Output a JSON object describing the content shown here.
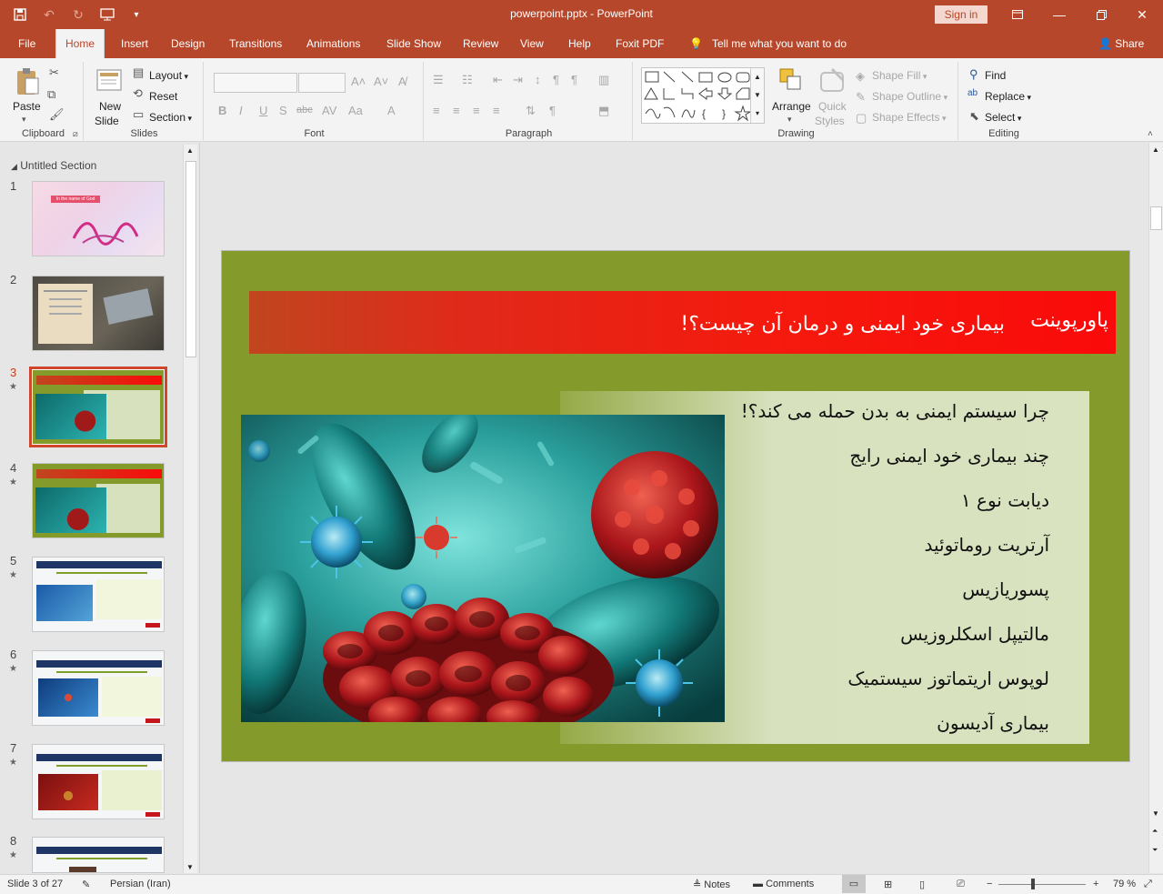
{
  "app": {
    "title": "powerpoint.pptx  -  PowerPoint",
    "sign_in": "Sign in",
    "qat_icons": [
      "save-icon",
      "undo-icon",
      "redo-icon",
      "start-from-beginning-icon",
      "customize-icon"
    ]
  },
  "tabs": [
    "File",
    "Home",
    "Insert",
    "Design",
    "Transitions",
    "Animations",
    "Slide Show",
    "Review",
    "View",
    "Help",
    "Foxit PDF"
  ],
  "active_tab": "Home",
  "tell_me": "Tell me what you want to do",
  "share": "Share",
  "ribbon": {
    "clipboard": {
      "paste": "Paste",
      "label": "Clipboard"
    },
    "slides": {
      "new_slide_1": "New",
      "new_slide_2": "Slide",
      "layout": "Layout",
      "reset": "Reset",
      "section": "Section",
      "label": "Slides"
    },
    "font": {
      "label": "Font",
      "bold": "B",
      "italic": "I",
      "underline": "U",
      "shadow": "S",
      "strike": "abc",
      "case": "Aa",
      "font_color": "A"
    },
    "paragraph": {
      "label": "Paragraph"
    },
    "drawing": {
      "arrange": "Arrange",
      "quick_styles_1": "Quick",
      "quick_styles_2": "Styles",
      "shape_fill": "Shape Fill",
      "shape_outline": "Shape Outline",
      "shape_effects": "Shape Effects",
      "label": "Drawing"
    },
    "editing": {
      "find": "Find",
      "replace": "Replace",
      "select": "Select",
      "label": "Editing"
    }
  },
  "thumbnails": {
    "section_name": "Untitled Section",
    "slide_numbers": [
      "1",
      "2",
      "3",
      "4",
      "5",
      "6",
      "7",
      "8"
    ],
    "selected": "3",
    "slide1_text": "In the name of God"
  },
  "slide": {
    "title_word": "پاورپوینت",
    "title": "بیماری خود ایمنی و درمان آن چیست؟!",
    "bullets": [
      "چرا سیستم ایمنی به بدن حمله می کند؟!",
      "چند بیماری خود ایمنی رایج",
      "دیابت نوع ۱",
      "آرتریت روماتوئید",
      "پسوریازیس",
      "مالتیپل اسکلروزیس",
      "لوپوس اریتماتوز سیستمیک",
      "بیماری آدیسون"
    ],
    "colors": {
      "background": "#849a2a",
      "title_bar": "#fa0a0a",
      "text_box": "#d7e1bd"
    }
  },
  "status": {
    "slide_info": "Slide 3 of 27",
    "language": "Persian (Iran)",
    "notes": "Notes",
    "comments": "Comments",
    "zoom": "79 %"
  }
}
